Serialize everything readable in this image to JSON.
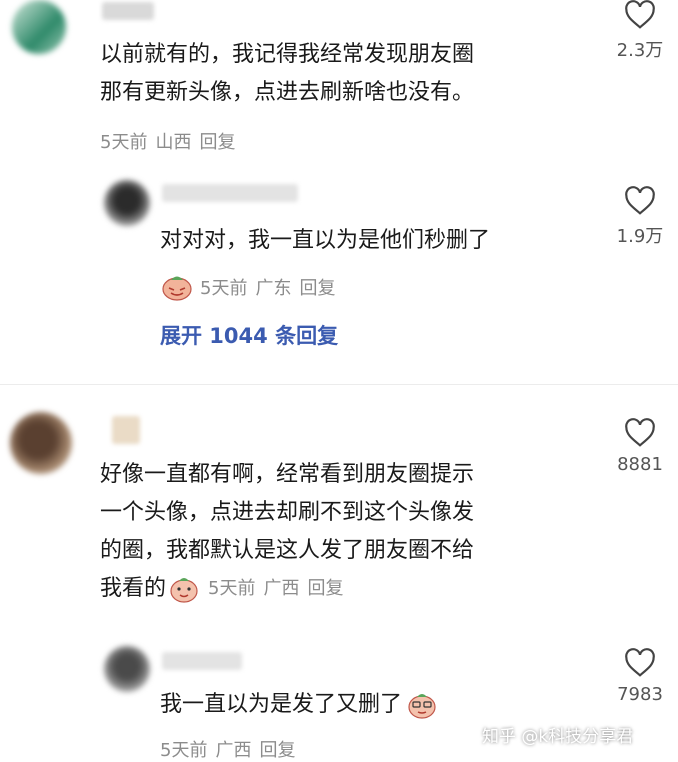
{
  "comments": [
    {
      "text_lines": [
        "以前就有的，我记得我经常发现朋友圈",
        "那有更新头像，点进去刷新啥也没有。"
      ],
      "time": "5天前",
      "location": "山西",
      "reply_label": "回复",
      "likes": "2.3万"
    },
    {
      "text_lines": [
        "对对对，我一直以为是他们秒删了"
      ],
      "time": "5天前",
      "location": "广东",
      "reply_label": "回复",
      "likes": "1.9万",
      "expand_label": "展开 1044 条回复"
    },
    {
      "text_lines": [
        "好像一直都有啊，经常看到朋友圈提示",
        "一个头像，点进去却刷不到这个头像发",
        "的圈，我都默认是这人发了朋友圈不给",
        "我看的"
      ],
      "time": "5天前",
      "location": "广西",
      "reply_label": "回复",
      "likes": "8881"
    },
    {
      "text_lines": [
        "我一直以为是发了又删了"
      ],
      "time": "5天前",
      "location": "广西",
      "reply_label": "回复",
      "likes": "7983"
    }
  ],
  "watermark": "知乎 @k科技分享君",
  "icons": {
    "like": "heart-outline-icon",
    "emoji": "emoji-sticker-icon"
  },
  "colors": {
    "link": "#3b5bb0",
    "meta": "#8c8c8c"
  }
}
